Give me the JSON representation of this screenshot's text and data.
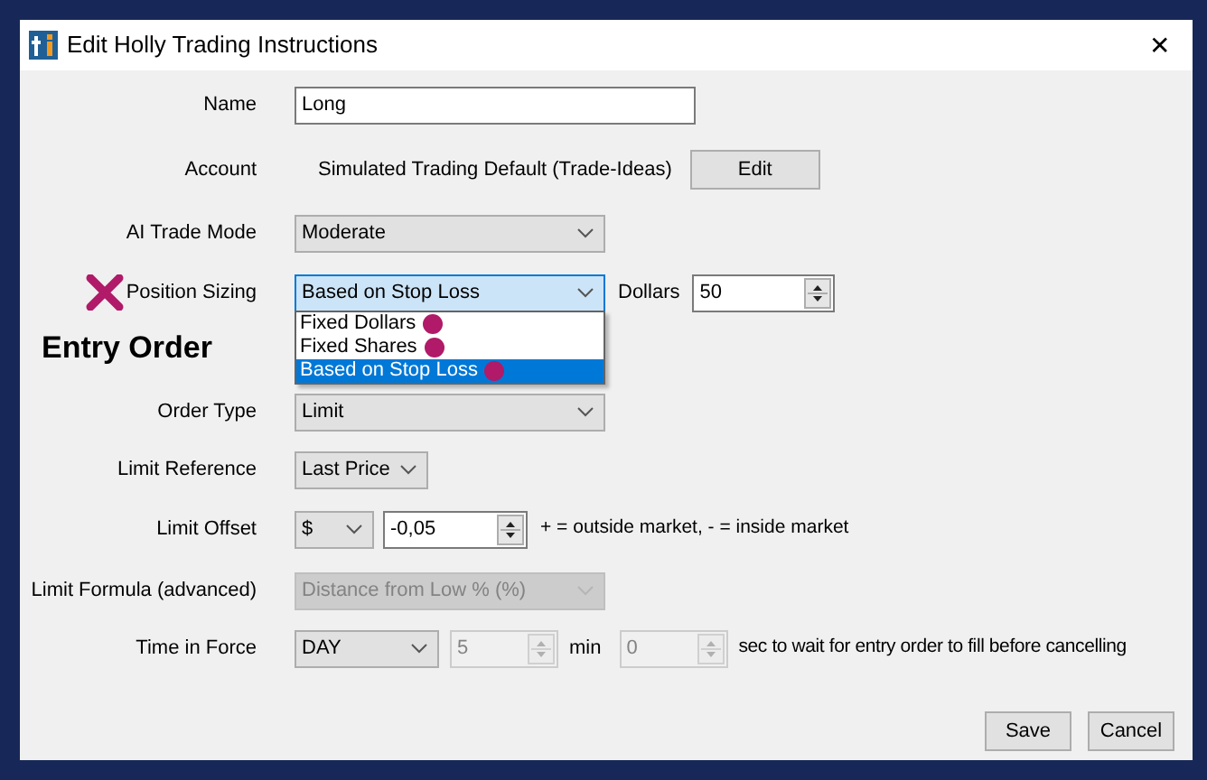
{
  "window": {
    "title": "Edit Holly Trading Instructions",
    "close": "✕"
  },
  "name": {
    "label": "Name",
    "value": "Long"
  },
  "account": {
    "label": "Account",
    "value": "Simulated Trading Default (Trade-Ideas)",
    "button": "Edit"
  },
  "ai_trade_mode": {
    "label": "AI Trade Mode",
    "value": "Moderate"
  },
  "position_sizing": {
    "label": "Position Sizing",
    "value": "Based on Stop Loss",
    "expanded": true,
    "options": [
      {
        "label": "Fixed Dollars",
        "selected": false
      },
      {
        "label": "Fixed Shares",
        "selected": false
      },
      {
        "label": "Based on Stop Loss",
        "selected": true
      }
    ],
    "amount_label": "Dollars",
    "amount": "50"
  },
  "section_heading": "Entry Order",
  "order_type": {
    "label": "Order Type",
    "value": "Limit"
  },
  "limit_reference": {
    "label": "Limit Reference",
    "value": "Last Price"
  },
  "limit_offset": {
    "label": "Limit Offset",
    "unit": "$",
    "value": "-0,05",
    "hint": "+ = outside market, - = inside market"
  },
  "limit_formula": {
    "label": "Limit Formula (advanced)",
    "value": "Distance from Low % (%)",
    "disabled": true
  },
  "time_in_force": {
    "label": "Time in Force",
    "value": "DAY",
    "minutes": "5",
    "minutes_disabled": true,
    "minutes_label": "min",
    "seconds": "0",
    "seconds_disabled": true,
    "hint": "sec to wait for entry order to fill before cancelling"
  },
  "buttons": [
    "Save",
    "Cancel"
  ]
}
